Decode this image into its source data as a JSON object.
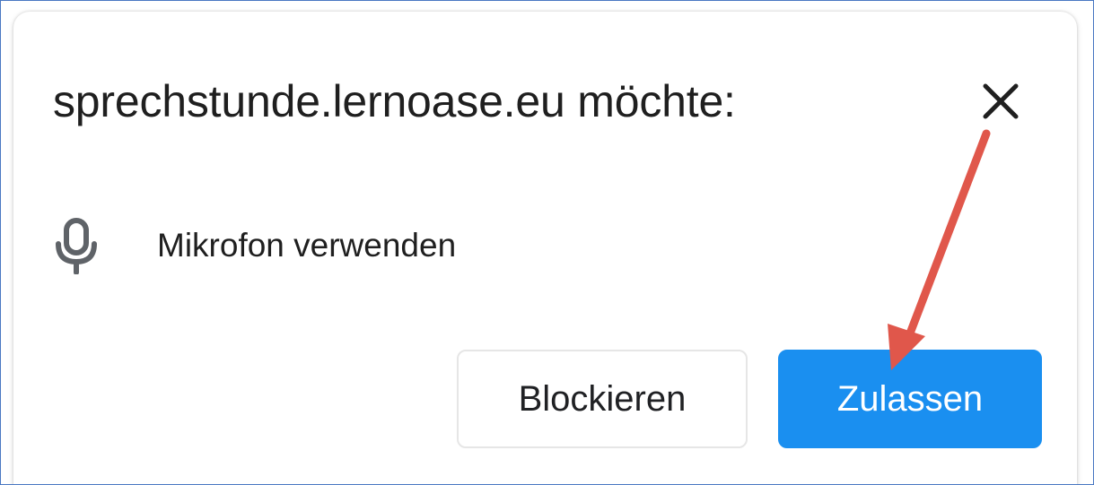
{
  "dialog": {
    "title": "sprechstunde.lernoase.eu möchte:",
    "close_icon": "close-icon",
    "permission": {
      "icon": "microphone-icon",
      "label": "Mikrofon verwenden"
    },
    "buttons": {
      "block_label": "Blockieren",
      "allow_label": "Zulassen"
    }
  },
  "annotation": {
    "arrow_color": "#e0574b",
    "points_to": "allow-button"
  },
  "colors": {
    "accent": "#1a8ff0",
    "frame_border": "#4a78c2",
    "text": "#1f1f1f"
  }
}
